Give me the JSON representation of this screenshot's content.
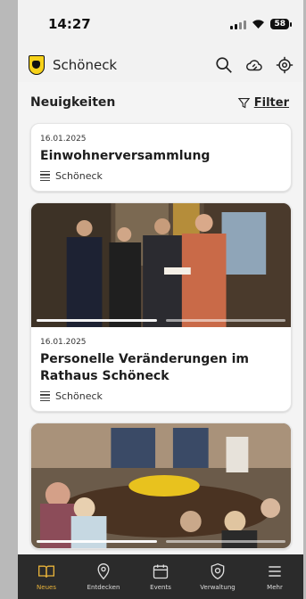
{
  "status": {
    "time": "14:27",
    "battery": "58"
  },
  "app": {
    "title": "Schöneck",
    "icons": [
      "search-icon",
      "weather-icon",
      "location-icon"
    ]
  },
  "section": {
    "title": "Neuigkeiten",
    "filter_label": "Filter"
  },
  "news": [
    {
      "date": "16.01.2025",
      "title": "Einwohnerversammlung",
      "location": "Schöneck"
    },
    {
      "date": "16.01.2025",
      "title": "Personelle Veränderungen im Rathaus Schöneck",
      "location": "Schöneck"
    }
  ],
  "tabs": [
    {
      "label": "Neues",
      "icon": "book-icon",
      "active": true
    },
    {
      "label": "Entdecken",
      "icon": "map-pin-icon",
      "active": false
    },
    {
      "label": "Events",
      "icon": "calendar-icon",
      "active": false
    },
    {
      "label": "Verwaltung",
      "icon": "shield-icon",
      "active": false
    },
    {
      "label": "Mehr",
      "icon": "menu-icon",
      "active": false
    }
  ],
  "colors": {
    "accent": "#e8b33a",
    "tabbar": "#2b2b2b",
    "background": "#f4f4f4"
  }
}
